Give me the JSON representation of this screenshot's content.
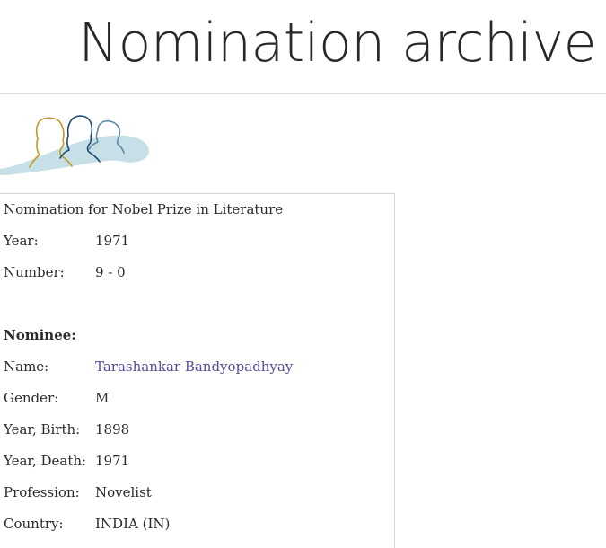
{
  "page": {
    "title": "Nomination archive"
  },
  "record": {
    "heading": "Nomination for Nobel Prize in Literature",
    "year_label": "Year:",
    "year_value": "1971",
    "number_label": "Number:",
    "number_value": "9 - 0"
  },
  "nominee": {
    "section_label": "Nominee:",
    "fields": [
      {
        "label": "Name:",
        "value": "Tarashankar Bandyopadhyay"
      },
      {
        "label": "Gender:",
        "value": "M"
      },
      {
        "label": "Year, Birth:",
        "value": "1898"
      },
      {
        "label": "Year, Death:",
        "value": "1971"
      },
      {
        "label": "Profession:",
        "value": "Novelist"
      },
      {
        "label": "Country:",
        "value": "INDIA (IN)"
      }
    ]
  },
  "colors": {
    "link": "#5b4a96",
    "logo_gold": "#c39a1f",
    "logo_navy": "#1d4a73",
    "logo_blue": "#5f8aa6",
    "logo_swoosh": "#c7dfe7"
  }
}
